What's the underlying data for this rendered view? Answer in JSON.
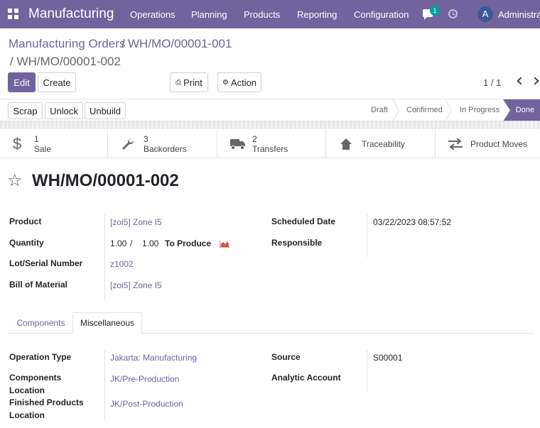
{
  "navbar": {
    "brand": "Manufacturing",
    "menu": [
      "Operations",
      "Planning",
      "Products",
      "Reporting",
      "Configuration"
    ],
    "chat_badge": "1",
    "avatar_initial": "A",
    "user": "Administrator"
  },
  "breadcrumb": {
    "parent": "Manufacturing Orders",
    "sep1": "/",
    "middle": "WH/MO/00001-001",
    "current": "/ WH/MO/00001-002"
  },
  "toolbar": {
    "edit": "Edit",
    "create": "Create",
    "print": "Print",
    "action": "Action",
    "pager": "1 / 1"
  },
  "statusbar": {
    "buttons": [
      "Scrap",
      "Unlock",
      "Unbuild"
    ],
    "stages": [
      "Draft",
      "Confirmed",
      "In Progress",
      "Done"
    ],
    "current_stage": "Done"
  },
  "smart_buttons": [
    {
      "icon": "dollar-icon",
      "count": "1",
      "label": "Sale"
    },
    {
      "icon": "wrench-icon",
      "count": "3",
      "label": "Backorders"
    },
    {
      "icon": "truck-icon",
      "count": "2",
      "label": "Transfers"
    },
    {
      "icon": "arrow-up-icon",
      "count": "",
      "label": "Traceability"
    },
    {
      "icon": "exchange-icon",
      "count": "",
      "label": "Product Moves"
    }
  ],
  "record": {
    "title": "WH/MO/00001-002",
    "fields_left": [
      {
        "label": "Product",
        "value": "[zoi5] Zone I5"
      },
      {
        "label": "Quantity",
        "qty": "1.00",
        "slash": "/",
        "qty_total": "1.00",
        "qty_suffix": "To Produce"
      },
      {
        "label": "Lot/Serial Number",
        "value": "z1002"
      },
      {
        "label": "Bill of Material",
        "value": "[zoi5] Zone I5"
      }
    ],
    "fields_right": [
      {
        "label": "Scheduled Date",
        "value": "03/22/2023 08:57:52"
      },
      {
        "label": "Responsible",
        "value": ""
      }
    ]
  },
  "tabs": [
    "Components",
    "Miscellaneous"
  ],
  "active_tab": "Miscellaneous",
  "misc": {
    "left": [
      {
        "label": "Operation Type",
        "value": "Jakarta: Manufacturing"
      },
      {
        "label_l1": "Components",
        "label_l2": "Location",
        "value": "JK/Pre-Production"
      },
      {
        "label_l1": "Finished Products",
        "label_l2": "Location",
        "value": "JK/Post-Production"
      }
    ],
    "right": [
      {
        "label": "Source",
        "value": "S00001"
      },
      {
        "label": "Analytic Account",
        "value": ""
      }
    ]
  },
  "colors": {
    "brand": "#71639e",
    "badge": "#00a09d",
    "chart_icon": "#d9534f"
  }
}
